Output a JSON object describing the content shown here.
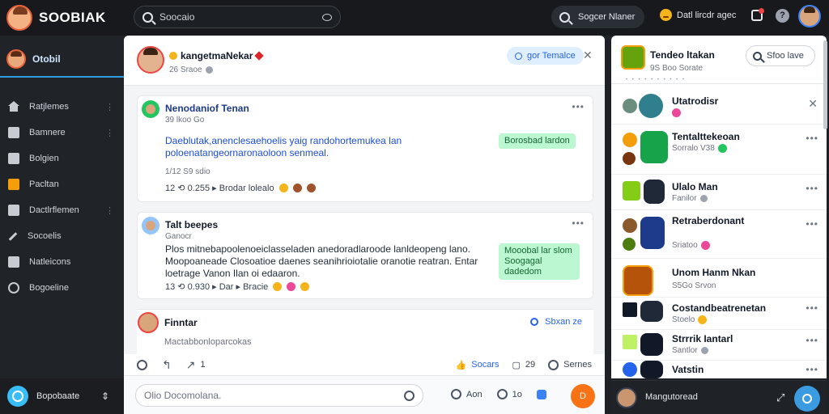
{
  "app": {
    "logo_text": "SOOBIAK",
    "search_placeholder": "Soocaio",
    "search_right_label": "Sogcer Nlaner",
    "status_text": "Datl lircdr agec"
  },
  "sidebar": {
    "profile_label": "Otobil",
    "items": [
      {
        "label": "Ratjlemes",
        "icon": "home-icon",
        "more": "⋮"
      },
      {
        "label": "Bamnere",
        "icon": "box-icon",
        "more": "⋮"
      },
      {
        "label": "Bolgien",
        "icon": "box-icon",
        "more": ""
      },
      {
        "label": "Pacltan",
        "icon": "orange-box-icon",
        "more": ""
      },
      {
        "label": "Dactlrflemen",
        "icon": "box-icon",
        "more": "⋮"
      },
      {
        "label": "Socoelis",
        "icon": "pen-icon",
        "more": ""
      },
      {
        "label": "Natleicons",
        "icon": "box-icon",
        "more": ""
      },
      {
        "label": "Bogoeline",
        "icon": "ring-icon",
        "more": ""
      }
    ],
    "bottom_label": "Bopobaate",
    "bottom_swap": "⇕"
  },
  "main": {
    "header": {
      "name": "kangetmaNekar",
      "sub": "26 Sraoe",
      "pill": "gor Temalce",
      "close": "✕"
    },
    "posts": [
      {
        "title": "Nenodaniof Tenan",
        "sub": "39 lkoo Go",
        "body": "Daeblutak,anenclesaehoelis yaig randohortemukea lan poloenatangeornaronaoloon senmeal.",
        "tag": "Borosbad lardon",
        "stat": "1/12 S9 sdio",
        "actions": "12 ⟲ 0.255 ▸ Brodar lolealo"
      },
      {
        "title": "Talt beepes",
        "sub": "Ganocr",
        "body": "Plos mitnebapoolenoeiclasseladen anedoradlaroode lanldeopeng lano. Moopoaneade Closoatioe daenes seanihrioiotalie oranotie reatran. Entar loetrage Vanon Ilan oi edaaron.",
        "tag": "Mooobal lar slom Soogagal dadedom",
        "stat": "",
        "actions": "13 ⟲ 0.930 ▸ Dar ▸ Bracie"
      }
    ],
    "third": {
      "name": "Finntar",
      "link": "Sbxan ze",
      "text": "Mactabbonloparcokas"
    },
    "action_row": {
      "retry": "",
      "share": "",
      "count": "1",
      "like_label": "Socars",
      "comment_count": "29",
      "more_label": "Sernes"
    },
    "compose": {
      "placeholder": "Olio Docomolana.",
      "tool_1": "Aon",
      "tool_2": "1o",
      "send": "D"
    }
  },
  "right": {
    "title": "Tendeo ltakan",
    "sub": "9S Boo Sorate",
    "search": "Sfoo lave",
    "dots": "• • • • • • • • • •",
    "contacts": [
      {
        "name": "Utatrodisr",
        "sub": "",
        "trailing": "✕"
      },
      {
        "name": "Tentalttekeoan",
        "sub": "Sorralo V38",
        "trailing": "•••"
      },
      {
        "name": "Ulalo Man",
        "sub": "Fanilor",
        "trailing": "•••"
      },
      {
        "name": "Retraberdonant",
        "sub": "Sriatoo",
        "trailing": "•••"
      },
      {
        "name": "Unom Hanm Nkan",
        "sub": "S5Go Srvon",
        "trailing": "•••"
      },
      {
        "name": "Costandbeatrenetan",
        "sub": "Stoelo",
        "trailing": "•••"
      },
      {
        "name": "Strrrik Iantarl",
        "sub": "Santlor",
        "trailing": "•••"
      },
      {
        "name": "Vatstin",
        "sub": "",
        "trailing": "•••"
      }
    ],
    "bottom_name": "Mangutoread"
  }
}
